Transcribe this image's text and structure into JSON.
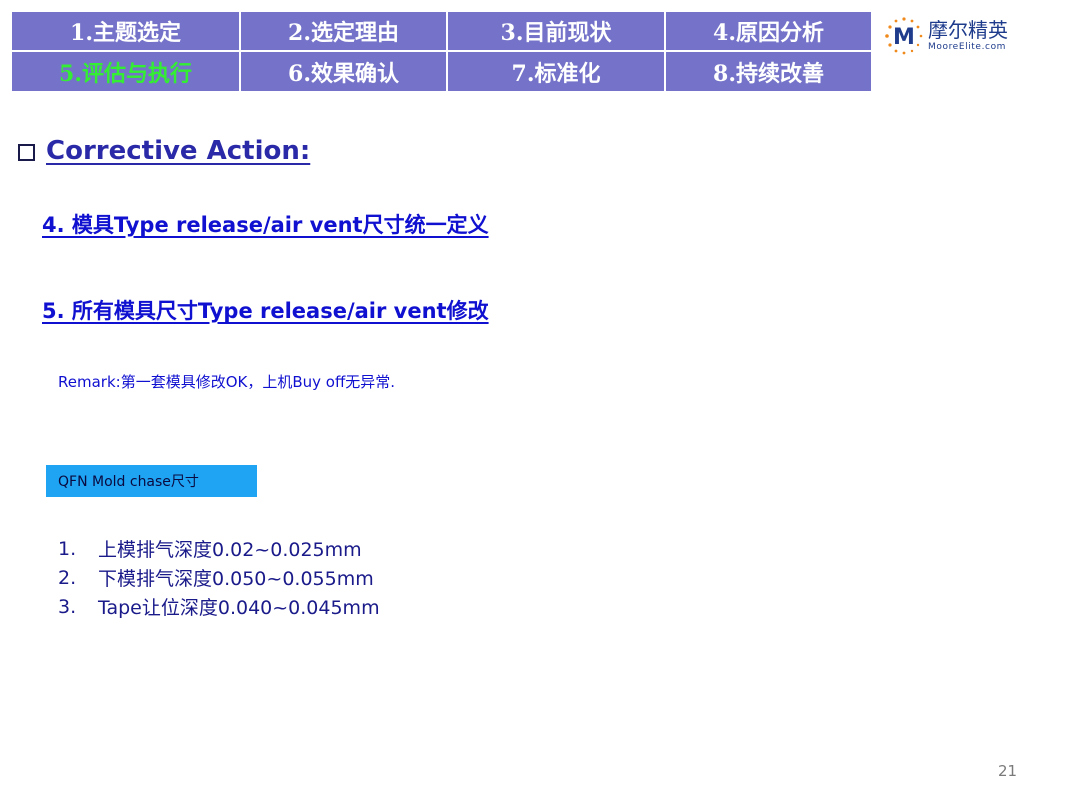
{
  "nav": {
    "items": [
      {
        "label": "1.主题选定"
      },
      {
        "label": "2.选定理由"
      },
      {
        "label": "3.目前现状"
      },
      {
        "label": "4.原因分析"
      },
      {
        "label": "5.评估与执行"
      },
      {
        "label": "6.效果确认"
      },
      {
        "label": "7.标准化"
      },
      {
        "label": "8.持续改善"
      }
    ],
    "active_index": 4,
    "cell_color": "#7472c9",
    "active_text_color": "#33ee33"
  },
  "logo": {
    "mark": "M",
    "name_cn": "摩尔精英",
    "name_en": "MooreElite.com",
    "brand_color": "#1f3c8c",
    "dot_color": "#f08a1c"
  },
  "heading": {
    "icon": "checkbox-icon",
    "text": "Corrective Action:"
  },
  "items": {
    "item4": "4. 模具Type release/air vent尺寸统一定义",
    "item5": "5. 所有模具尺寸Type release/air vent修改"
  },
  "remark": "Remark:第一套模具修改OK，上机Buy off无异常.",
  "label_box": {
    "text": "QFN Mold chase尺寸",
    "color": "#1ea4f2"
  },
  "specs": [
    {
      "num": "1.",
      "text": "上模排气深度0.02~0.025mm"
    },
    {
      "num": "2.",
      "text": "下模排气深度0.050~0.055mm"
    },
    {
      "num": "3.",
      "text": "Tape让位深度0.040~0.045mm"
    }
  ],
  "page_number": "21"
}
